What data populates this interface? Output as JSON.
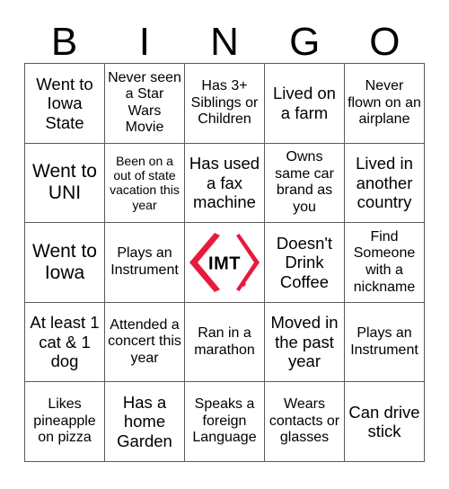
{
  "card": {
    "type": "bingo-card",
    "grid_size": "5x5",
    "header_letters": [
      "B",
      "I",
      "N",
      "G",
      "O"
    ],
    "colors": {
      "logo_red": "#E8193C",
      "grid_line": "#5A5A5A",
      "text": "#000000",
      "background": "#FFFFFF"
    },
    "rows": [
      [
        {
          "text": "Went to Iowa State",
          "size": "lg"
        },
        {
          "text": "Never seen a Star Wars Movie",
          "size": "md"
        },
        {
          "text": "Has 3+ Siblings or Children",
          "size": "md"
        },
        {
          "text": "Lived on a farm",
          "size": "lg"
        },
        {
          "text": "Never flown on an airplane",
          "size": "md"
        }
      ],
      [
        {
          "text": "Went to UNI",
          "size": "xl"
        },
        {
          "text": "Been on a out of state vacation this year",
          "size": "sm"
        },
        {
          "text": "Has used a fax machine",
          "size": "lg"
        },
        {
          "text": "Owns same car brand as you",
          "size": "md"
        },
        {
          "text": "Lived in another country",
          "size": "lg"
        }
      ],
      [
        {
          "text": "Went to Iowa",
          "size": "xl"
        },
        {
          "text": "Plays an Instrument",
          "size": "md"
        },
        {
          "text": "",
          "size": "md",
          "logo": "imt-logo",
          "logo_text": "IMT",
          "free_space": true
        },
        {
          "text": "Doesn't Drink Coffee",
          "size": "lg"
        },
        {
          "text": "Find Someone with a nickname",
          "size": "md"
        }
      ],
      [
        {
          "text": "At least 1 cat & 1 dog",
          "size": "lg"
        },
        {
          "text": "Attended a concert this year",
          "size": "md"
        },
        {
          "text": "Ran in a marathon",
          "size": "md"
        },
        {
          "text": "Moved in the past year",
          "size": "lg"
        },
        {
          "text": "Plays an Instrument",
          "size": "md"
        }
      ],
      [
        {
          "text": "Likes pineapple on pizza",
          "size": "md"
        },
        {
          "text": "Has a home Garden",
          "size": "lg"
        },
        {
          "text": "Speaks a foreign Language",
          "size": "md"
        },
        {
          "text": "Wears contacts or glasses",
          "size": "md"
        },
        {
          "text": "Can drive stick",
          "size": "lg"
        }
      ]
    ]
  }
}
